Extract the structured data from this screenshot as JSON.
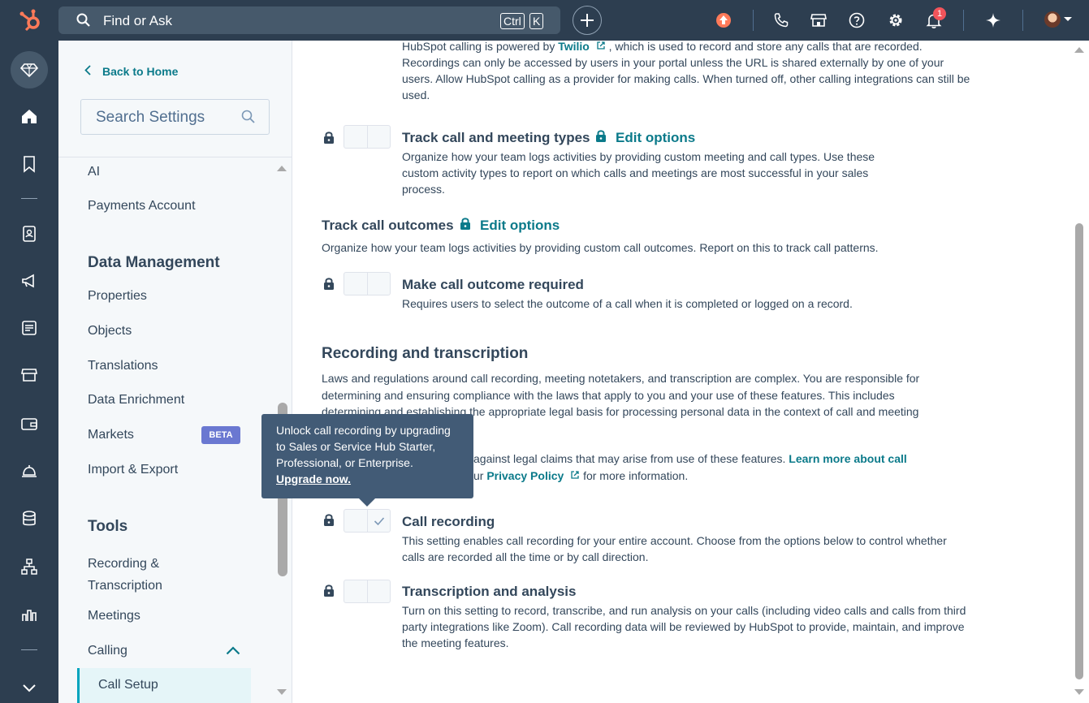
{
  "topbar": {
    "search_placeholder": "Find or Ask",
    "kbd_ctrl": "Ctrl",
    "kbd_k": "K",
    "notification_count": "1"
  },
  "sidebar": {
    "back_label": "Back to Home",
    "search_placeholder": "Search Settings",
    "items_top": [
      "AI",
      "Payments Account"
    ],
    "data_management_heading": "Data Management",
    "data_management_items": [
      "Properties",
      "Objects",
      "Translations",
      "Data Enrichment",
      "Markets",
      "Import & Export"
    ],
    "beta_label": "BETA",
    "tools_heading": "Tools",
    "tools_items": [
      "Recording & Transcription",
      "Meetings",
      "Calling"
    ],
    "active_item": "Call Setup"
  },
  "main": {
    "intro_line1_a": "HubSpot calling is powered by ",
    "intro_link": "Twilio",
    "intro_line1_b": " , which is used to record and store any calls that are recorded.",
    "intro_rest": "Recordings can only be accessed by users in your portal unless the URL is shared externally by one of your users. Allow HubSpot calling as a provider for making calls. When turned off, other calling integrations can still be used.",
    "track_types_title": "Track call and meeting types",
    "track_types_edit": "Edit options",
    "track_types_desc": "Organize how your team logs activities by providing custom meeting and call types. Use these custom activity types to report on which calls and meetings are most successful in your sales process.",
    "outcomes_title": "Track call outcomes",
    "outcomes_edit": "Edit options",
    "outcomes_desc": "Organize how your team logs activities by providing custom call outcomes. Report on this to track call patterns.",
    "required_title": "Make call outcome required",
    "required_desc": "Requires users to select the outcome of a call when it is completed or logged on a record.",
    "rec_heading": "Recording and transcription",
    "rec_desc_1": "Laws and regulations around call recording, meeting notetakers, and transcription are complex. You are responsible for",
    "rec_desc_2": "determining and ensuring compliance with the laws that apply to you and your use of these features. This includes",
    "rec_desc_3": "determining and establishing the appropriate legal basis for processing personal data in the context of call and meeting",
    "rec_desc_4a": "against legal claims that may arise from use of these features. ",
    "rec_learn_more": "Learn more about call",
    "rec_desc_5a": "ur ",
    "rec_privacy": "Privacy Policy",
    "rec_desc_5b": " for more information.",
    "call_rec_title": "Call recording",
    "call_rec_desc": "This setting enables call recording for your entire account. Choose from the options below to control whether calls are recorded all the time or by call direction.",
    "transcription_title": "Transcription and analysis",
    "transcription_desc": "Turn on this setting to record, transcribe, and run analysis on your calls (including video calls and calls from third party integrations like Zoom). Call recording data will be reviewed by HubSpot to provide, maintain, and improve the meeting features."
  },
  "tooltip": {
    "text": "Unlock call recording by upgrading to Sales or Service Hub Starter, Professional, or Enterprise.",
    "upgrade": "Upgrade now."
  },
  "colors": {
    "nav_bg": "#2d3e50",
    "accent": "#0b7a8a",
    "brand": "#ff7a59",
    "tooltip_bg": "#425b76"
  }
}
